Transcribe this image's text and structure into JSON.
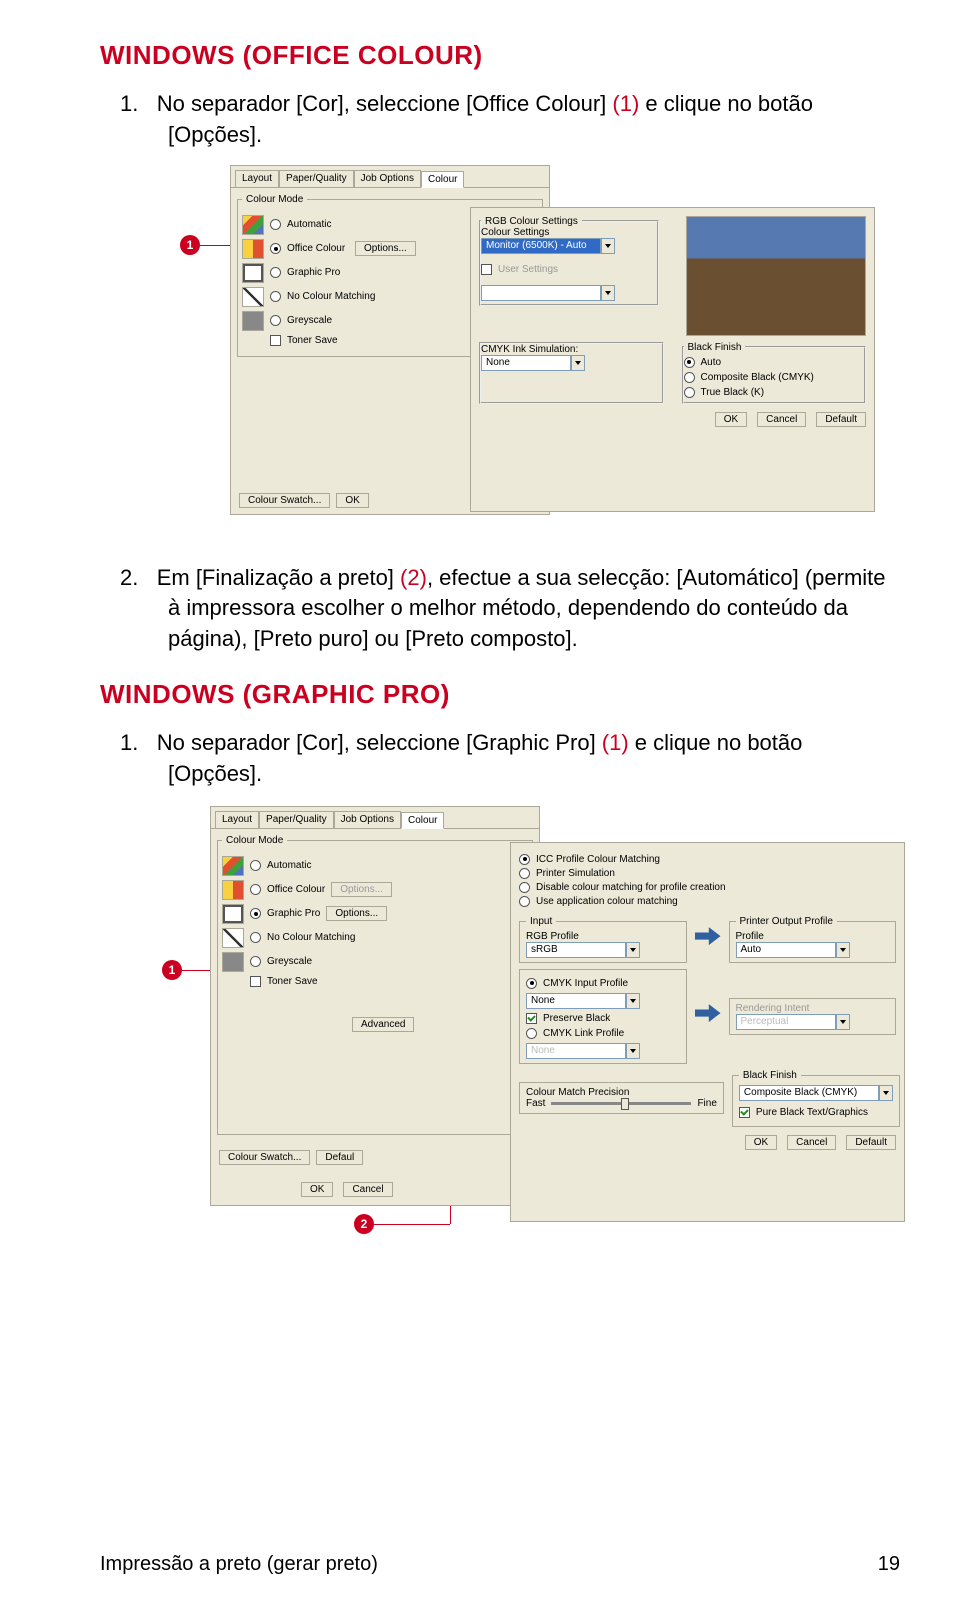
{
  "sections": {
    "s1_title": "WINDOWS (OFFICE COLOUR)",
    "s2_title": "WINDOWS (GRAPHIC PRO)"
  },
  "items": {
    "s1_1_a": "1.",
    "s1_1_b": "No separador [Cor], seleccione [Office Colour] ",
    "s1_1_c": "(1)",
    "s1_1_d": " e clique no botão [Opções].",
    "s1_2_a": "2.",
    "s1_2_b": "Em [Finalização a preto] ",
    "s1_2_c": "(2)",
    "s1_2_d": ", efectue a sua selecção: [Automático] (permite à impressora escolher o melhor método, dependendo do conteúdo da página), [Preto puro] ou [Preto composto].",
    "s2_1_a": "1.",
    "s2_1_b": "No separador [Cor], seleccione [Graphic Pro] ",
    "s2_1_c": "(1)",
    "s2_1_d": " e clique no botão [Opções]."
  },
  "markers": {
    "m1": "1",
    "m2": "2"
  },
  "tabs": {
    "layout": "Layout",
    "paper": "Paper/Quality",
    "job": "Job Options",
    "colour": "Colour"
  },
  "colour_mode_legend": "Colour Mode",
  "radios": {
    "automatic": "Automatic",
    "office": "Office Colour",
    "gpro": "Graphic Pro",
    "nomatch": "No Colour Matching",
    "grey": "Greyscale",
    "icc_match": "ICC Profile Colour Matching",
    "printer_sim": "Printer Simulation",
    "disable": "Disable colour matching for profile creation",
    "use_app": "Use application colour matching",
    "auto_bf": "Auto",
    "comp_black": "Composite Black (CMYK)",
    "true_black": "True Black (K)"
  },
  "checkboxes": {
    "toner_save": "Toner Save",
    "user_settings": "User Settings",
    "preserve_black": "Preserve Black",
    "cmyk_link": "CMYK Link Profile",
    "pure_black": "Pure Black Text/Graphics"
  },
  "buttons": {
    "options": "Options...",
    "colour_swatch": "Colour Swatch...",
    "ok": "OK",
    "cancel": "Cancel",
    "default": "Default",
    "advanced": "Advanced",
    "defaul": "Defaul"
  },
  "labels": {
    "rgb_legend": "RGB Colour Settings",
    "colour_settings": "Colour Settings",
    "monitor_auto": "Monitor (6500K) - Auto",
    "cmyk_sim": "CMYK Ink Simulation:",
    "none": "None",
    "black_finish": "Black Finish",
    "input_legend": "Input",
    "rgb_profile": "RGB Profile",
    "srgb": "sRGB",
    "cmyk_input": "CMYK Input Profile",
    "printer_out_legend": "Printer Output Profile",
    "profile": "Profile",
    "auto_val": "Auto",
    "rendering": "Rendering Intent",
    "perceptual": "Perceptual",
    "match_precision": "Colour Match Precision",
    "fast": "Fast",
    "fine": "Fine"
  },
  "footer": {
    "text": "Impressão a preto (gerar preto)",
    "page": "19"
  }
}
